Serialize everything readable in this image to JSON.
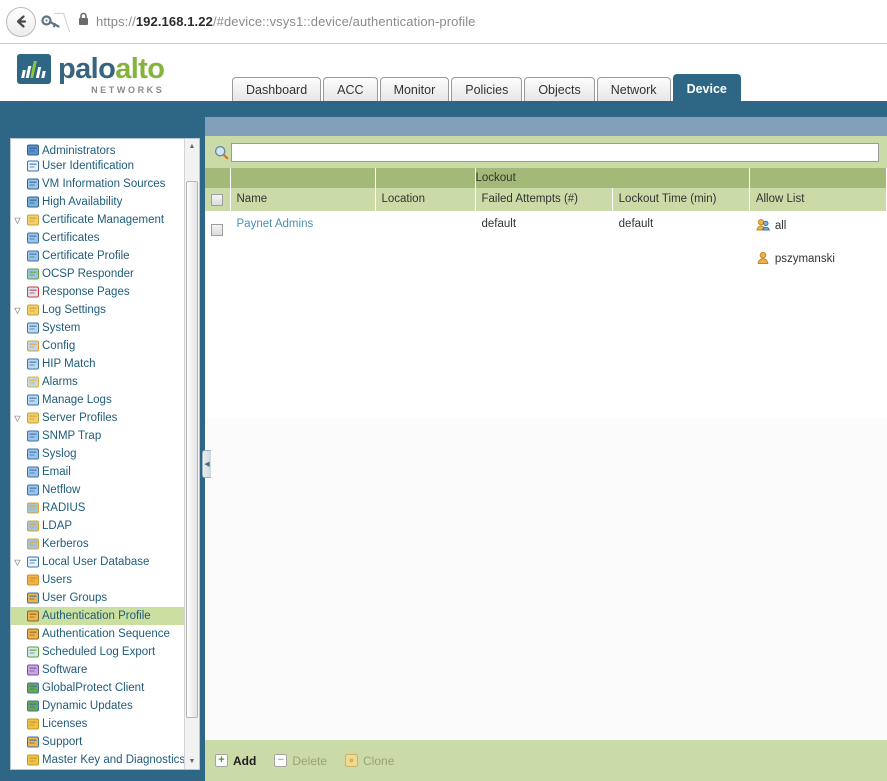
{
  "browser": {
    "back_icon": "back-arrow-icon",
    "identity_icon": "key-icon",
    "lock_icon": "padlock-icon",
    "url_scheme": "https://",
    "url_host": "192.168.1.22",
    "url_path": "/#device::vsys1::device/authentication-profile"
  },
  "brand": {
    "word_1": "palo",
    "word_2": "alto",
    "tagline": "NETWORKS",
    "mark_icon": "paloalto-logo-icon",
    "color_blue": "#39647f",
    "color_green": "#86b33c"
  },
  "tabs": [
    {
      "label": "Dashboard",
      "active": false
    },
    {
      "label": "ACC",
      "active": false
    },
    {
      "label": "Monitor",
      "active": false
    },
    {
      "label": "Policies",
      "active": false
    },
    {
      "label": "Objects",
      "active": false
    },
    {
      "label": "Network",
      "active": false
    },
    {
      "label": "Device",
      "active": true
    }
  ],
  "sidebar": {
    "scroll_up_icon": "triangle-up-icon",
    "scroll_down_icon": "triangle-down-icon",
    "collapse_icon": "chevron-left-icon",
    "items": [
      {
        "label": "Administrators",
        "indent": 0,
        "icon": "administrators-icon",
        "twisty": "",
        "selected": false,
        "clipped": true
      },
      {
        "label": "User Identification",
        "indent": 0,
        "icon": "user-identification-icon",
        "twisty": "",
        "selected": false
      },
      {
        "label": "VM Information Sources",
        "indent": 0,
        "icon": "vm-information-icon",
        "twisty": "",
        "selected": false
      },
      {
        "label": "High Availability",
        "indent": 0,
        "icon": "high-availability-icon",
        "twisty": "",
        "selected": false
      },
      {
        "label": "Certificate Management",
        "indent": 0,
        "icon": "folder-certificate-icon",
        "twisty": "▽",
        "selected": false
      },
      {
        "label": "Certificates",
        "indent": 1,
        "icon": "certificate-icon",
        "twisty": "",
        "selected": false
      },
      {
        "label": "Certificate Profile",
        "indent": 1,
        "icon": "certificate-icon",
        "twisty": "",
        "selected": false
      },
      {
        "label": "OCSP Responder",
        "indent": 1,
        "icon": "ocsp-responder-icon",
        "twisty": "",
        "selected": false
      },
      {
        "label": "Response Pages",
        "indent": 0,
        "icon": "response-pages-icon",
        "twisty": "",
        "selected": false
      },
      {
        "label": "Log Settings",
        "indent": 0,
        "icon": "folder-log-icon",
        "twisty": "▽",
        "selected": false
      },
      {
        "label": "System",
        "indent": 1,
        "icon": "log-system-icon",
        "twisty": "",
        "selected": false
      },
      {
        "label": "Config",
        "indent": 1,
        "icon": "log-config-icon",
        "twisty": "",
        "selected": false
      },
      {
        "label": "HIP Match",
        "indent": 1,
        "icon": "log-hip-match-icon",
        "twisty": "",
        "selected": false
      },
      {
        "label": "Alarms",
        "indent": 1,
        "icon": "log-alarms-icon",
        "twisty": "",
        "selected": false
      },
      {
        "label": "Manage Logs",
        "indent": 1,
        "icon": "manage-logs-icon",
        "twisty": "",
        "selected": false
      },
      {
        "label": "Server Profiles",
        "indent": 0,
        "icon": "folder-server-icon",
        "twisty": "▽",
        "selected": false
      },
      {
        "label": "SNMP Trap",
        "indent": 1,
        "icon": "server-profile-icon",
        "twisty": "",
        "selected": false
      },
      {
        "label": "Syslog",
        "indent": 1,
        "icon": "server-profile-icon",
        "twisty": "",
        "selected": false
      },
      {
        "label": "Email",
        "indent": 1,
        "icon": "server-profile-icon",
        "twisty": "",
        "selected": false
      },
      {
        "label": "Netflow",
        "indent": 1,
        "icon": "server-profile-icon",
        "twisty": "",
        "selected": false
      },
      {
        "label": "RADIUS",
        "indent": 1,
        "icon": "server-auth-icon",
        "twisty": "",
        "selected": false
      },
      {
        "label": "LDAP",
        "indent": 1,
        "icon": "server-auth-icon",
        "twisty": "",
        "selected": false
      },
      {
        "label": "Kerberos",
        "indent": 1,
        "icon": "server-auth-icon",
        "twisty": "",
        "selected": false
      },
      {
        "label": "Local User Database",
        "indent": 0,
        "icon": "local-user-database-icon",
        "twisty": "▽",
        "selected": false
      },
      {
        "label": "Users",
        "indent": 1,
        "icon": "user-icon",
        "twisty": "",
        "selected": false
      },
      {
        "label": "User Groups",
        "indent": 1,
        "icon": "user-group-icon",
        "twisty": "",
        "selected": false
      },
      {
        "label": "Authentication Profile",
        "indent": 0,
        "icon": "authentication-profile-icon",
        "twisty": "",
        "selected": true
      },
      {
        "label": "Authentication Sequence",
        "indent": 0,
        "icon": "authentication-sequence-icon",
        "twisty": "",
        "selected": false
      },
      {
        "label": "Scheduled Log Export",
        "indent": 0,
        "icon": "scheduled-log-export-icon",
        "twisty": "",
        "selected": false
      },
      {
        "label": "Software",
        "indent": 0,
        "icon": "software-icon",
        "twisty": "",
        "selected": false
      },
      {
        "label": "GlobalProtect Client",
        "indent": 0,
        "icon": "globalprotect-client-icon",
        "twisty": "",
        "selected": false
      },
      {
        "label": "Dynamic Updates",
        "indent": 0,
        "icon": "dynamic-updates-icon",
        "twisty": "",
        "selected": false
      },
      {
        "label": "Licenses",
        "indent": 0,
        "icon": "license-key-icon",
        "twisty": "",
        "selected": false
      },
      {
        "label": "Support",
        "indent": 0,
        "icon": "support-icon",
        "twisty": "",
        "selected": false
      },
      {
        "label": "Master Key and Diagnostics",
        "indent": 0,
        "icon": "master-key-icon",
        "twisty": "",
        "selected": false
      }
    ]
  },
  "search": {
    "icon": "search-magnifier-icon",
    "value": "",
    "placeholder": ""
  },
  "table": {
    "group_header": "Lockout",
    "columns": [
      "Name",
      "Location",
      "Failed Attempts (#)",
      "Lockout Time (min)",
      "Allow List"
    ],
    "header_checkbox_icon": "checkbox-unchecked-icon",
    "rows": [
      {
        "checkbox_icon": "checkbox-unchecked-icon",
        "name": "Paynet Admins",
        "location": "",
        "failed_attempts": "default",
        "lockout_time": "default",
        "allow_list": [
          {
            "label": "all",
            "icon": "user-group-icon"
          },
          {
            "label": "pszymanski",
            "icon": "user-icon"
          }
        ]
      }
    ]
  },
  "footer": {
    "buttons": [
      {
        "label": "Add",
        "icon": "plus-icon",
        "glyph": "+",
        "enabled": true
      },
      {
        "label": "Delete",
        "icon": "minus-icon",
        "glyph": "−",
        "enabled": false
      },
      {
        "label": "Clone",
        "icon": "clone-icon",
        "glyph": "●",
        "enabled": false
      }
    ]
  },
  "theme": {
    "header_blue": "#2e6685",
    "band_blue": "#82a0ba",
    "group_header_green": "#a3b977",
    "column_header_green": "#cbdba8",
    "selected_row_green": "#cbdfa0",
    "link_blue": "#4a8fb5"
  }
}
